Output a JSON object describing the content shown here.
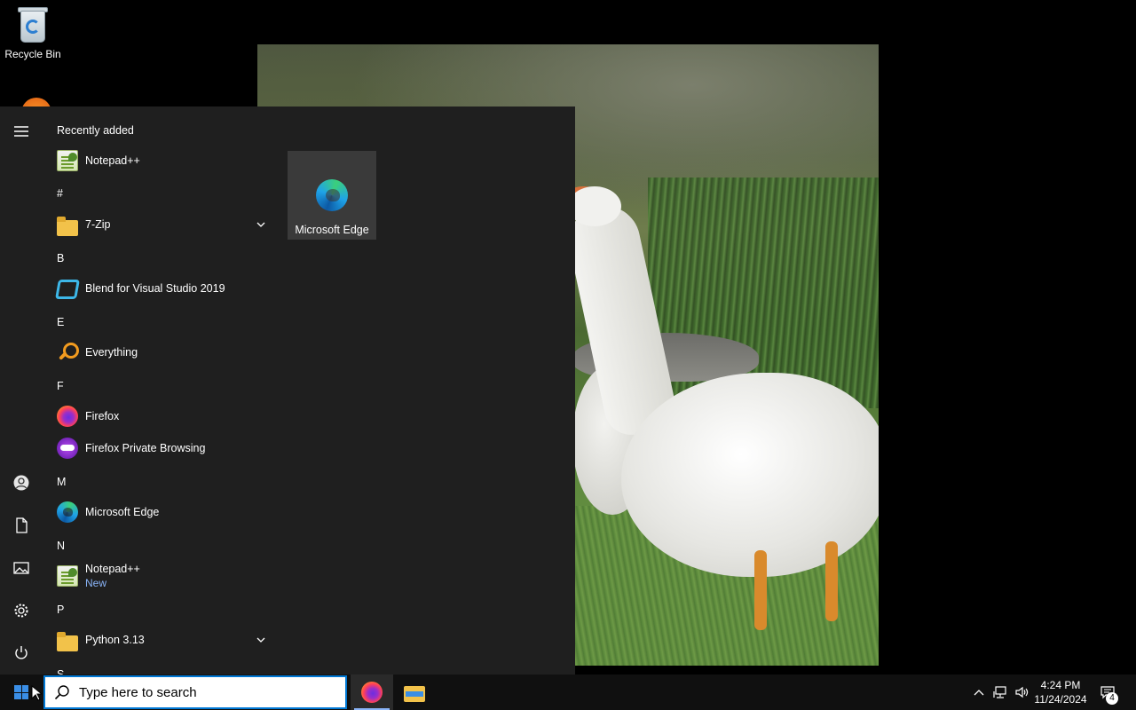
{
  "desktop": {
    "icons": [
      {
        "label": "Recycle Bin",
        "icon": "recycle-bin-icon"
      }
    ],
    "photo": {
      "subject": "goose-photo"
    }
  },
  "start_menu": {
    "section_title": "Recently added",
    "recent": [
      {
        "label": "Notepad++",
        "icon": "notepad-plus-plus-icon"
      }
    ],
    "letters": [
      "#",
      "B",
      "E",
      "F",
      "M",
      "N",
      "P",
      "S"
    ],
    "apps": [
      {
        "label": "7-Zip",
        "icon": "folder-icon",
        "expandable": true
      },
      {
        "label": "Blend for Visual Studio 2019",
        "icon": "blend-icon"
      },
      {
        "label": "Everything",
        "icon": "everything-search-icon"
      },
      {
        "label": "Firefox",
        "icon": "firefox-icon"
      },
      {
        "label": "Firefox Private Browsing",
        "icon": "firefox-private-icon"
      },
      {
        "label": "Microsoft Edge",
        "icon": "edge-icon"
      },
      {
        "label": "Notepad++",
        "sublabel": "New",
        "icon": "notepad-plus-plus-icon"
      },
      {
        "label": "Python 3.13",
        "icon": "folder-icon",
        "expandable": true
      }
    ],
    "tiles": [
      {
        "label": "Microsoft Edge",
        "icon": "edge-icon"
      }
    ],
    "rail": [
      "hamburger-menu-icon",
      "user-icon",
      "documents-icon",
      "pictures-icon",
      "settings-gear-icon",
      "power-icon"
    ]
  },
  "taskbar": {
    "search": {
      "placeholder": "Type here to search"
    },
    "pinned": [
      {
        "name": "firefox",
        "icon": "firefox-icon",
        "active": true
      },
      {
        "name": "file-explorer",
        "icon": "file-explorer-icon",
        "active": false
      }
    ],
    "tray": {
      "time": "4:24 PM",
      "date": "11/24/2024",
      "notification_count": "4"
    }
  },
  "colors": {
    "start_bg": "#1f1f1f",
    "taskbar_bg": "#101010",
    "accent": "#0078d4",
    "tile_bg": "#3a3a3a"
  }
}
